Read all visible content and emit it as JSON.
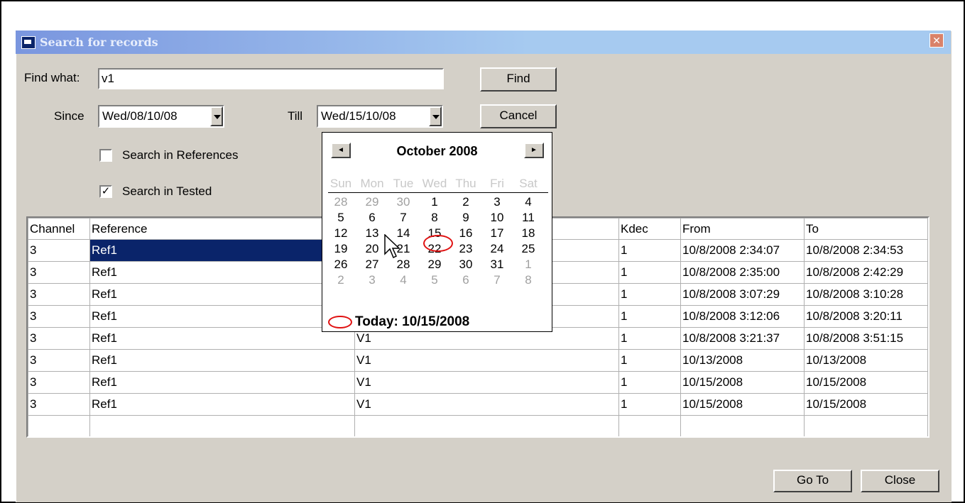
{
  "window": {
    "title": "Search for records",
    "close_glyph": "✕"
  },
  "form": {
    "find_label": "Find what:",
    "find_value": "v1",
    "since_label": "Since",
    "since_value": "Wed/08/10/08",
    "till_label": "Till",
    "till_value": "Wed/15/10/08",
    "search_references_label": "Search in References",
    "search_references_checked": false,
    "search_tested_label": "Search in Tested",
    "search_tested_checked": true,
    "checkmark_glyph": "✓",
    "find_button": "Find",
    "cancel_button": "Cancel"
  },
  "calendar": {
    "month_title": "October 2008",
    "prev_glyph": "◄",
    "next_glyph": "►",
    "weekdays": [
      "Sun",
      "Mon",
      "Tue",
      "Wed",
      "Thu",
      "Fri",
      "Sat"
    ],
    "weeks": [
      [
        "28",
        "29",
        "30",
        "1",
        "2",
        "3",
        "4"
      ],
      [
        "5",
        "6",
        "7",
        "8",
        "9",
        "10",
        "11"
      ],
      [
        "12",
        "13",
        "14",
        "15",
        "16",
        "17",
        "18"
      ],
      [
        "19",
        "20",
        "21",
        "22",
        "23",
        "24",
        "25"
      ],
      [
        "26",
        "27",
        "28",
        "29",
        "30",
        "31",
        "1"
      ],
      [
        "2",
        "3",
        "4",
        "5",
        "6",
        "7",
        "8"
      ]
    ],
    "selected_day": "15",
    "today_label": "Today: 10/15/2008"
  },
  "table": {
    "columns": [
      "Channel",
      "Reference",
      "",
      "Kdec",
      "From",
      "To"
    ],
    "rows": [
      [
        "3",
        "Ref1",
        "",
        "1",
        "10/8/2008 2:34:07",
        "10/8/2008 2:34:53"
      ],
      [
        "3",
        "Ref1",
        "",
        "1",
        "10/8/2008 2:35:00",
        "10/8/2008 2:42:29"
      ],
      [
        "3",
        "Ref1",
        "",
        "1",
        "10/8/2008 3:07:29",
        "10/8/2008 3:10:28"
      ],
      [
        "3",
        "Ref1",
        "",
        "1",
        "10/8/2008 3:12:06",
        "10/8/2008 3:20:11"
      ],
      [
        "3",
        "Ref1",
        "V1",
        "1",
        "10/8/2008 3:21:37",
        "10/8/2008 3:51:15"
      ],
      [
        "3",
        "Ref1",
        "V1",
        "1",
        "10/13/2008",
        "10/13/2008"
      ],
      [
        "3",
        "Ref1",
        "V1",
        "1",
        "10/15/2008",
        "10/15/2008"
      ],
      [
        "3",
        "Ref1",
        "V1",
        "1",
        "10/15/2008",
        "10/15/2008"
      ]
    ],
    "selected_row": 0
  },
  "footer": {
    "goto_button": "Go To",
    "close_button": "Close"
  }
}
